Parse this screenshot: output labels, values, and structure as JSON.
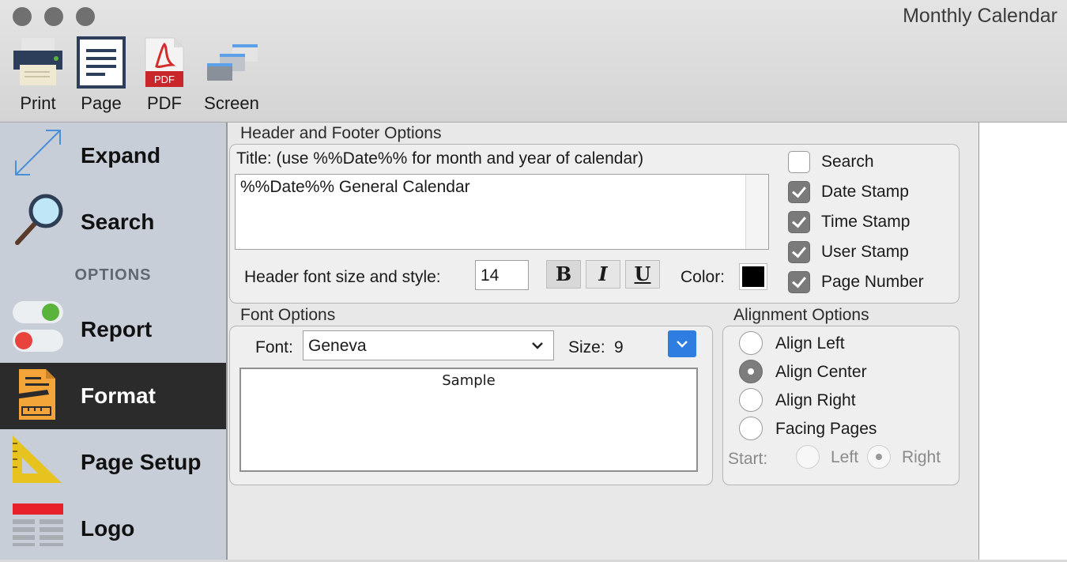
{
  "window": {
    "title": "Monthly Calendar"
  },
  "toolbar": [
    {
      "label": "Print",
      "icon": "printer-icon"
    },
    {
      "label": "Page",
      "icon": "page-icon"
    },
    {
      "label": "PDF",
      "icon": "pdf-icon",
      "badge": "PDF"
    },
    {
      "label": "Screen",
      "icon": "screen-icon"
    }
  ],
  "sidebar": {
    "items": [
      {
        "label": "Expand",
        "icon": "expand-arrows-icon"
      },
      {
        "label": "Search",
        "icon": "magnifier-icon"
      },
      {
        "label": "Report",
        "icon": "toggle-switches-icon"
      },
      {
        "label": "Format",
        "icon": "format-document-icon",
        "active": true
      },
      {
        "label": "Page Setup",
        "icon": "triangle-ruler-icon"
      },
      {
        "label": "Logo",
        "icon": "logo-table-icon"
      }
    ],
    "section_label": "OPTIONS"
  },
  "header_footer": {
    "section_title": "Header and Footer Options",
    "title_label": "Title: (use %%Date%% for month and year of calendar)",
    "title_value": "%%Date%% General Calendar",
    "font_size_label": "Header font size and style:",
    "font_size_value": "14",
    "bold": "B",
    "italic": "I",
    "underline": "U",
    "color_label": "Color:",
    "color_value": "#000000",
    "checkboxes": [
      {
        "label": "Search",
        "checked": false
      },
      {
        "label": "Date Stamp",
        "checked": true
      },
      {
        "label": "Time Stamp",
        "checked": true
      },
      {
        "label": "User Stamp",
        "checked": true
      },
      {
        "label": "Page Number",
        "checked": true
      }
    ]
  },
  "font_options": {
    "section_title": "Font Options",
    "font_label": "Font:",
    "font_value": "Geneva",
    "size_label": "Size:",
    "size_value": "9",
    "sample_text": "Sample"
  },
  "alignment": {
    "section_title": "Alignment Options",
    "options": [
      {
        "label": "Align Left",
        "selected": false
      },
      {
        "label": "Align Center",
        "selected": true
      },
      {
        "label": "Align Right",
        "selected": false
      },
      {
        "label": "Facing Pages",
        "selected": false
      }
    ],
    "start_label": "Start:",
    "start_options": [
      {
        "label": "Left",
        "selected": false
      },
      {
        "label": "Right",
        "selected": true
      }
    ]
  },
  "colors": {
    "active_sidebar": "#2b2b2b",
    "accent_blue": "#2f7de1",
    "toggle_green": "#5ab33a",
    "toggle_red": "#e8433c"
  }
}
